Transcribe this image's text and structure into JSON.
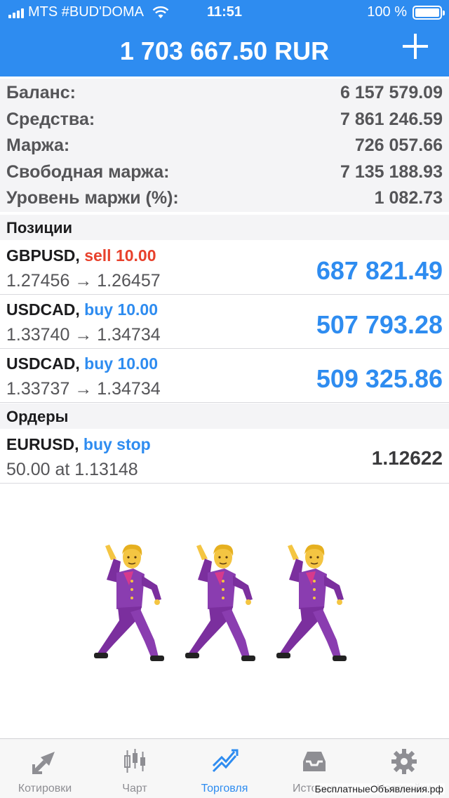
{
  "status_bar": {
    "carrier": "MTS #BUD'DOMA",
    "time": "11:51",
    "battery": "100 %",
    "battery_level": 1.0
  },
  "header": {
    "equity": "1 703 667.50 RUR"
  },
  "summary": [
    {
      "label": "Баланс:",
      "value": "6 157 579.09"
    },
    {
      "label": "Средства:",
      "value": "7 861 246.59"
    },
    {
      "label": "Маржа:",
      "value": "726 057.66"
    },
    {
      "label": "Свободная маржа:",
      "value": "7 135 188.93"
    },
    {
      "label": "Уровень маржи (%):",
      "value": "1 082.73"
    }
  ],
  "positions": {
    "title": "Позиции",
    "items": [
      {
        "symbol": "GBPUSD,",
        "side": "sell 10.00",
        "prices": "1.27456 → 1.26457",
        "profit": "687 821.49"
      },
      {
        "symbol": "USDCAD,",
        "side": "buy 10.00",
        "prices": "1.33740 → 1.34734",
        "profit": "507 793.28"
      },
      {
        "symbol": "USDCAD,",
        "side": "buy 10.00",
        "prices": "1.33737 → 1.34734",
        "profit": "509 325.86"
      }
    ]
  },
  "orders": {
    "title": "Ордеры",
    "items": [
      {
        "symbol": "EURUSD,",
        "side": "buy stop",
        "details": "50.00 at 1.13148",
        "price": "1.12622"
      }
    ]
  },
  "emoji": [
    "man-dancing",
    "man-dancing",
    "man-dancing"
  ],
  "tabs": [
    {
      "label": "Котировки",
      "icon": "quotes-arrows-icon",
      "active": false
    },
    {
      "label": "Чарт",
      "icon": "candlestick-icon",
      "active": false
    },
    {
      "label": "Торговля",
      "icon": "trade-chart-icon",
      "active": true
    },
    {
      "label": "История",
      "icon": "inbox-tray-icon",
      "active": false
    },
    {
      "label": "Настройки",
      "icon": "gear-icon",
      "active": false
    }
  ],
  "watermark": "БесплатныеОбъявления.рф",
  "colors": {
    "accent": "#2e8cf0",
    "sell": "#e8412c",
    "buy": "#2e8cf0",
    "profit": "#2e8cf0",
    "inactive_tab": "#8e8e93"
  }
}
